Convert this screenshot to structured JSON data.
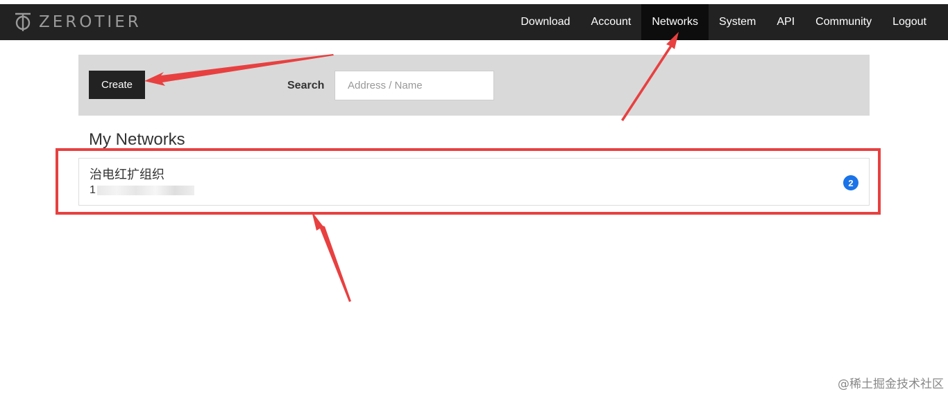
{
  "brand": {
    "logo_text": "ZEROTIER",
    "logo_icon": "zerotier-logo-icon"
  },
  "nav": {
    "items": [
      {
        "label": "Download"
      },
      {
        "label": "Account"
      },
      {
        "label": "Networks",
        "active": true
      },
      {
        "label": "System"
      },
      {
        "label": "API"
      },
      {
        "label": "Community"
      },
      {
        "label": "Logout"
      }
    ]
  },
  "toolbar": {
    "create_label": "Create",
    "search_label": "Search",
    "search_placeholder": "Address / Name",
    "search_value": ""
  },
  "networks": {
    "title": "My Networks",
    "items": [
      {
        "name": "治电红扩组织",
        "id_visible": "1",
        "id_redacted": true,
        "member_count": "2"
      }
    ]
  },
  "annotation": {
    "color": "#e84040"
  },
  "colors": {
    "navbar": "#222222",
    "toolbar_bg": "#d9d9d9",
    "badge": "#1a73e8"
  },
  "watermark": "@稀土掘金技术社区"
}
